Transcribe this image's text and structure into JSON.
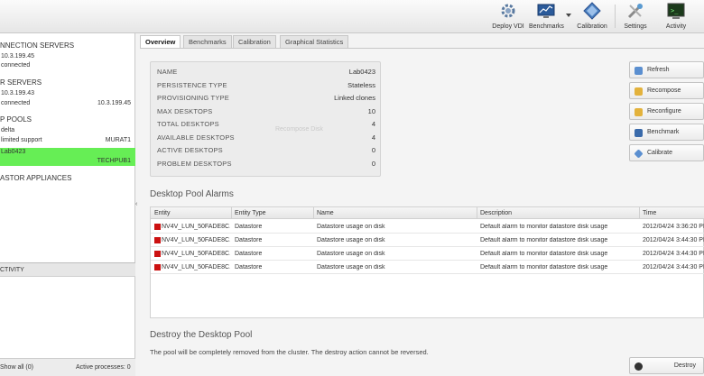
{
  "toolbar": {
    "items": [
      {
        "label": "Deploy VDI",
        "icon": "gear-icon"
      },
      {
        "label": "Benchmarks",
        "icon": "benchmarks-icon"
      },
      {
        "label": "Calibration",
        "icon": "calibration-icon"
      },
      {
        "label": "Settings",
        "icon": "settings-icon"
      },
      {
        "label": "Activity",
        "icon": "activity-icon"
      }
    ]
  },
  "left_panel": {
    "connection_servers": {
      "title": "NNECTION SERVERS",
      "items": [
        {
          "line1": "10.3.199.45",
          "line2": "connected"
        }
      ]
    },
    "r_servers": {
      "title": "R SERVERS",
      "items": [
        {
          "line1": "10.3.199.43",
          "line2": "connected",
          "right": "10.3.199.45"
        }
      ]
    },
    "pools": {
      "title": "P POOLS",
      "items": [
        {
          "line1": "delta",
          "line2": "limited support",
          "right": "MURAT1"
        },
        {
          "line1": "Lab0423",
          "right": "TECHPUB1"
        }
      ]
    },
    "appliances": {
      "title": "ASTOR APPLIANCES"
    },
    "activity": {
      "title": "CTIVITY"
    },
    "footer": {
      "show_all": "Show all (0)",
      "active": "Active processes: 0"
    }
  },
  "tabs": [
    "Overview",
    "Benchmarks",
    "Calibration",
    "Graphical Statistics"
  ],
  "summary": [
    {
      "key": "NAME",
      "value": "Lab0423"
    },
    {
      "key": "PERSISTENCE TYPE",
      "value": "Stateless"
    },
    {
      "key": "PROVISIONING TYPE",
      "value": "Linked clones"
    },
    {
      "key": "MAX DESKTOPS",
      "value": "10"
    },
    {
      "key": "TOTAL DESKTOPS",
      "value": "4"
    },
    {
      "key": "AVAILABLE DESKTOPS",
      "value": "4"
    },
    {
      "key": "ACTIVE DESKTOPS",
      "value": "0"
    },
    {
      "key": "PROBLEM DESKTOPS",
      "value": "0"
    }
  ],
  "ghost_label": "Recompose Disk",
  "actions": [
    "Refresh",
    "Recompose",
    "Reconfigure",
    "Benchmark",
    "Calibrate"
  ],
  "alarms": {
    "title": "Desktop Pool Alarms",
    "columns": [
      "Entity",
      "Entity Type",
      "Name",
      "Description",
      "Time"
    ],
    "rows": [
      [
        "NV4V_LUN_50FADE8C...",
        "Datastore",
        "Datastore usage on disk",
        "Default alarm to monitor datastore disk usage",
        "2012/04/24 3:36:20 PM"
      ],
      [
        "NV4V_LUN_50FADE8C...",
        "Datastore",
        "Datastore usage on disk",
        "Default alarm to monitor datastore disk usage",
        "2012/04/24 3:44:30 PM"
      ],
      [
        "NV4V_LUN_50FADE8C...",
        "Datastore",
        "Datastore usage on disk",
        "Default alarm to monitor datastore disk usage",
        "2012/04/24 3:44:30 PM"
      ],
      [
        "NV4V_LUN_50FADE8C...",
        "Datastore",
        "Datastore usage on disk",
        "Default alarm to monitor datastore disk usage",
        "2012/04/24 3:44:30 PM"
      ]
    ]
  },
  "destroy": {
    "title": "Destroy the Desktop Pool",
    "text": "The pool will be completely removed from the cluster. The destroy action cannot be reversed.",
    "button": "Destroy"
  },
  "colors": {
    "selected_row": "#66ee55",
    "alarm_red": "#cc1111"
  }
}
